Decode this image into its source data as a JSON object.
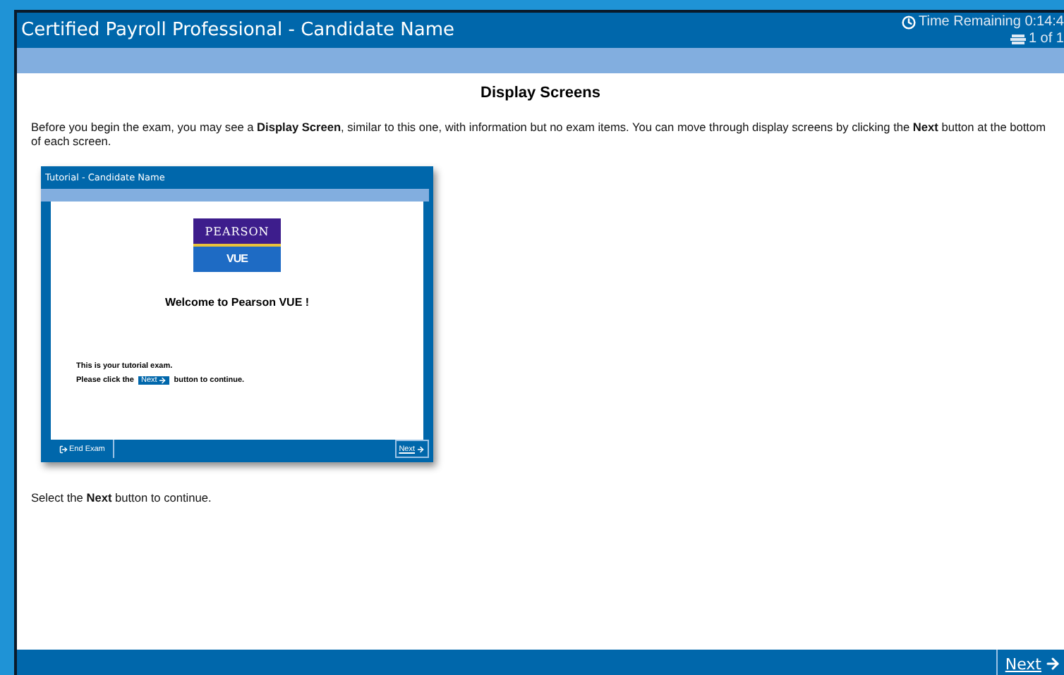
{
  "window": {
    "title": "Certified Payroll Professional - Candidate Name",
    "time_remaining": "Time Remaining 0:14:4",
    "page_counter": "1 of 1"
  },
  "content": {
    "heading": "Display Screens",
    "intro": "Before you begin the exam, you may see a **Display Screen**, similar to this one, with information but no exam items. You can move through display screens by clicking the **Next** button at the bottom of each screen.",
    "tutorial_preview": {
      "title": "Tutorial - Candidate Name",
      "logo_top": "PEARSON",
      "logo_bottom": "VUE",
      "welcome": "Welcome to Pearson VUE !",
      "line_1": "This is your tutorial exam.",
      "line_2_before": "Please click the",
      "line_2_button": "Next",
      "line_2_after": "button to continue.",
      "end_exam": "End Exam",
      "next": "Next"
    },
    "instruction": "Select the **Next** button to continue."
  },
  "footer": {
    "next": "Next"
  }
}
